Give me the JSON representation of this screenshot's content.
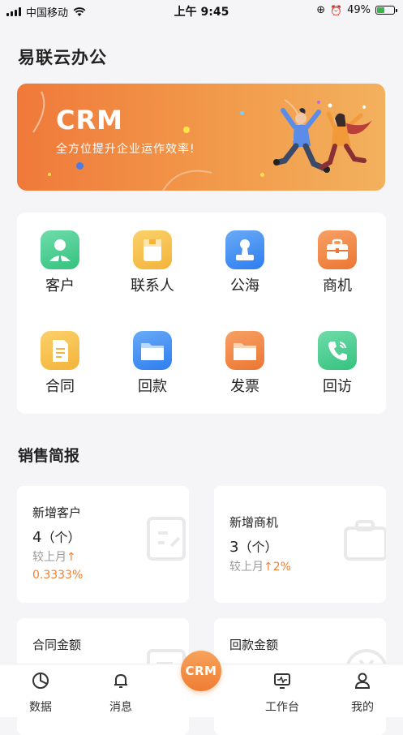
{
  "status_bar": {
    "carrier": "中国移动",
    "time": "上午 9:45",
    "battery_pct": "49%",
    "battery_level": 0.49
  },
  "header": {
    "title": "易联云办公"
  },
  "banner": {
    "brand": "CRM",
    "slogan": "全方位提升企业运作效率!"
  },
  "menu": {
    "items": [
      {
        "label": "客户",
        "icon": "customer-icon",
        "color": "#3cc58a"
      },
      {
        "label": "联系人",
        "icon": "contact-icon",
        "color": "#f5b740"
      },
      {
        "label": "公海",
        "icon": "public-sea-icon",
        "color": "#3d8ff0"
      },
      {
        "label": "商机",
        "icon": "opportunity-icon",
        "color": "#f07e3a"
      },
      {
        "label": "合同",
        "icon": "contract-icon",
        "color": "#f5b740"
      },
      {
        "label": "回款",
        "icon": "payment-icon",
        "color": "#3d8ff0"
      },
      {
        "label": "发票",
        "icon": "invoice-icon",
        "color": "#f07e3a"
      },
      {
        "label": "回访",
        "icon": "callback-icon",
        "color": "#3cc58a"
      }
    ]
  },
  "sales_report": {
    "title": "销售简报",
    "cards": [
      {
        "title": "新增客户",
        "value": "4",
        "unit": "（个）",
        "compare_label": "较上月",
        "arrow": "↑",
        "change": "0.3333%"
      },
      {
        "title": "新增商机",
        "value": "3",
        "unit": "（个）",
        "compare_label": "较上月",
        "arrow": "↑",
        "change": "2%"
      },
      {
        "title": "合同金额"
      },
      {
        "title": "回款金额"
      }
    ]
  },
  "tabbar": {
    "items": [
      {
        "label": "数据",
        "icon": "pie-chart-icon"
      },
      {
        "label": "消息",
        "icon": "bell-icon"
      },
      {
        "label": "CRM",
        "icon": "crm-center-button"
      },
      {
        "label": "工作台",
        "icon": "monitor-icon"
      },
      {
        "label": "我的",
        "icon": "user-icon"
      }
    ]
  },
  "colors": {
    "accent": "#f0802f",
    "background": "#f5f5f7"
  }
}
